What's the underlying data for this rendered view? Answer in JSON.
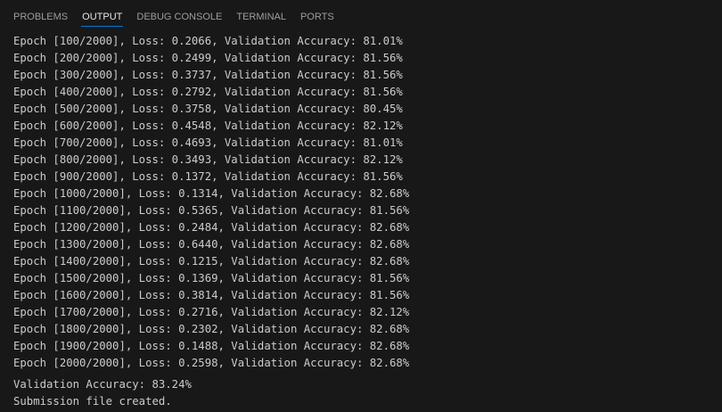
{
  "panel": {
    "tabs": [
      {
        "label": "PROBLEMS",
        "active": false
      },
      {
        "label": "OUTPUT",
        "active": true
      },
      {
        "label": "DEBUG CONSOLE",
        "active": false
      },
      {
        "label": "TERMINAL",
        "active": false
      },
      {
        "label": "PORTS",
        "active": false
      }
    ]
  },
  "output": {
    "epoch_lines": [
      "Epoch [100/2000], Loss: 0.2066, Validation Accuracy: 81.01%",
      "Epoch [200/2000], Loss: 0.2499, Validation Accuracy: 81.56%",
      "Epoch [300/2000], Loss: 0.3737, Validation Accuracy: 81.56%",
      "Epoch [400/2000], Loss: 0.2792, Validation Accuracy: 81.56%",
      "Epoch [500/2000], Loss: 0.3758, Validation Accuracy: 80.45%",
      "Epoch [600/2000], Loss: 0.4548, Validation Accuracy: 82.12%",
      "Epoch [700/2000], Loss: 0.4693, Validation Accuracy: 81.01%",
      "Epoch [800/2000], Loss: 0.3493, Validation Accuracy: 82.12%",
      "Epoch [900/2000], Loss: 0.1372, Validation Accuracy: 81.56%",
      "Epoch [1000/2000], Loss: 0.1314, Validation Accuracy: 82.68%",
      "Epoch [1100/2000], Loss: 0.5365, Validation Accuracy: 81.56%",
      "Epoch [1200/2000], Loss: 0.2484, Validation Accuracy: 82.68%",
      "Epoch [1300/2000], Loss: 0.6440, Validation Accuracy: 82.68%",
      "Epoch [1400/2000], Loss: 0.1215, Validation Accuracy: 82.68%",
      "Epoch [1500/2000], Loss: 0.1369, Validation Accuracy: 81.56%",
      "Epoch [1600/2000], Loss: 0.3814, Validation Accuracy: 81.56%",
      "Epoch [1700/2000], Loss: 0.2716, Validation Accuracy: 82.12%",
      "Epoch [1800/2000], Loss: 0.2302, Validation Accuracy: 82.68%",
      "Epoch [1900/2000], Loss: 0.1488, Validation Accuracy: 82.68%",
      "Epoch [2000/2000], Loss: 0.2598, Validation Accuracy: 82.68%"
    ],
    "final_lines": [
      "Validation Accuracy: 83.24%",
      "Submission file created."
    ]
  },
  "colors": {
    "background": "#181818",
    "text": "#cccccc",
    "tab_inactive": "#9d9d9d",
    "tab_active": "#e7e7e7",
    "accent": "#0078d4"
  }
}
